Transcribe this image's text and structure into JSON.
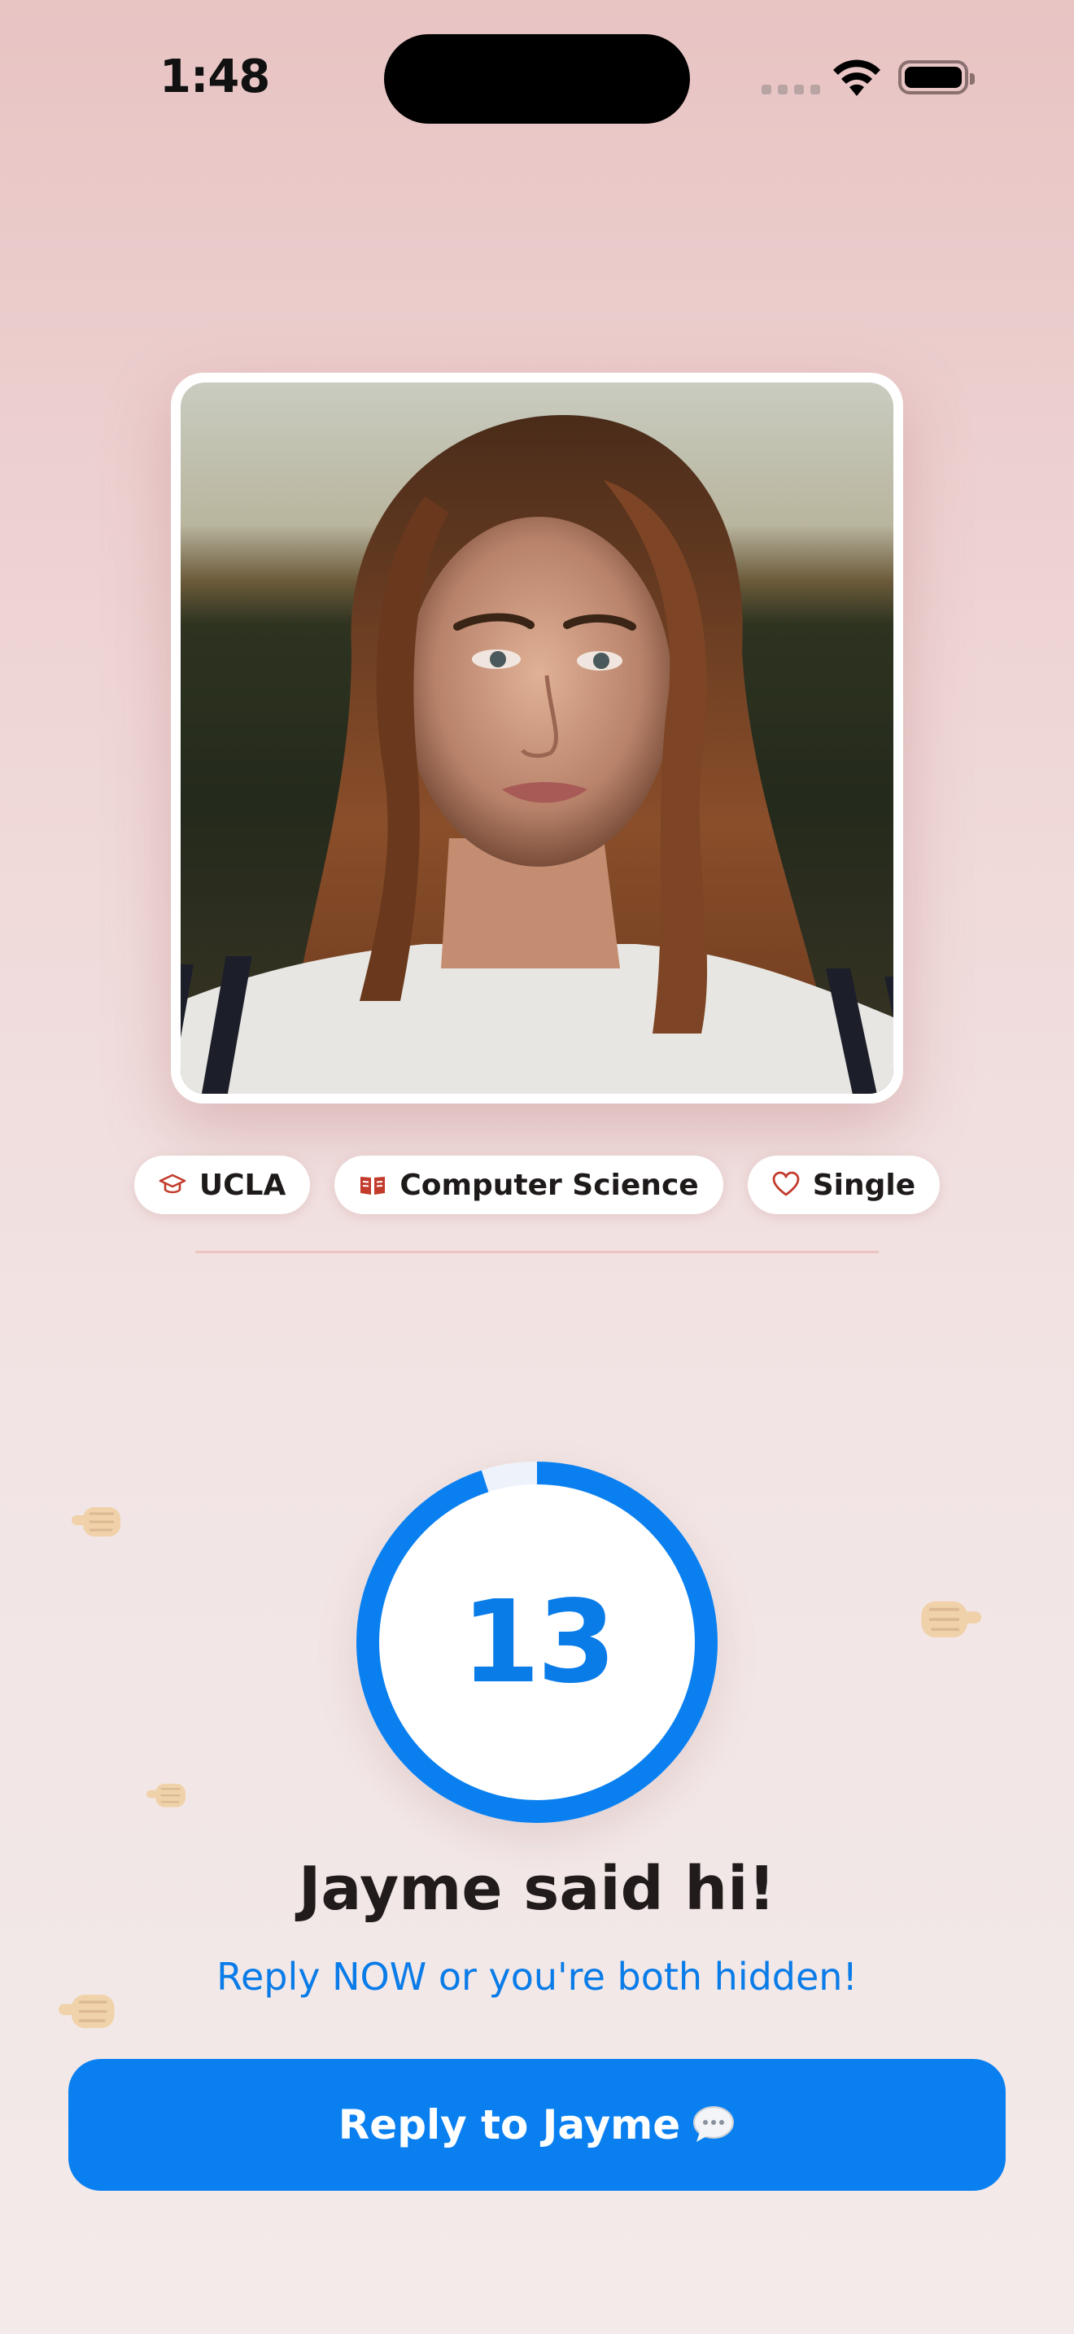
{
  "status_bar": {
    "time": "1:48"
  },
  "profile": {
    "photo_alt": "Profile photo",
    "tags": [
      {
        "icon": "graduation-cap-icon",
        "label": "UCLA"
      },
      {
        "icon": "book-icon",
        "label": "Computer Science"
      },
      {
        "icon": "heart-icon",
        "label": "Single"
      }
    ]
  },
  "timer": {
    "value": "13",
    "progress_fraction": 0.95
  },
  "message": {
    "headline": "Jayme said hi!",
    "subline": "Reply NOW or you're both hidden!"
  },
  "cta": {
    "label": "Reply to Jayme"
  },
  "colors": {
    "accent": "#0a80f0",
    "tag_icon": "#c23b2c"
  }
}
